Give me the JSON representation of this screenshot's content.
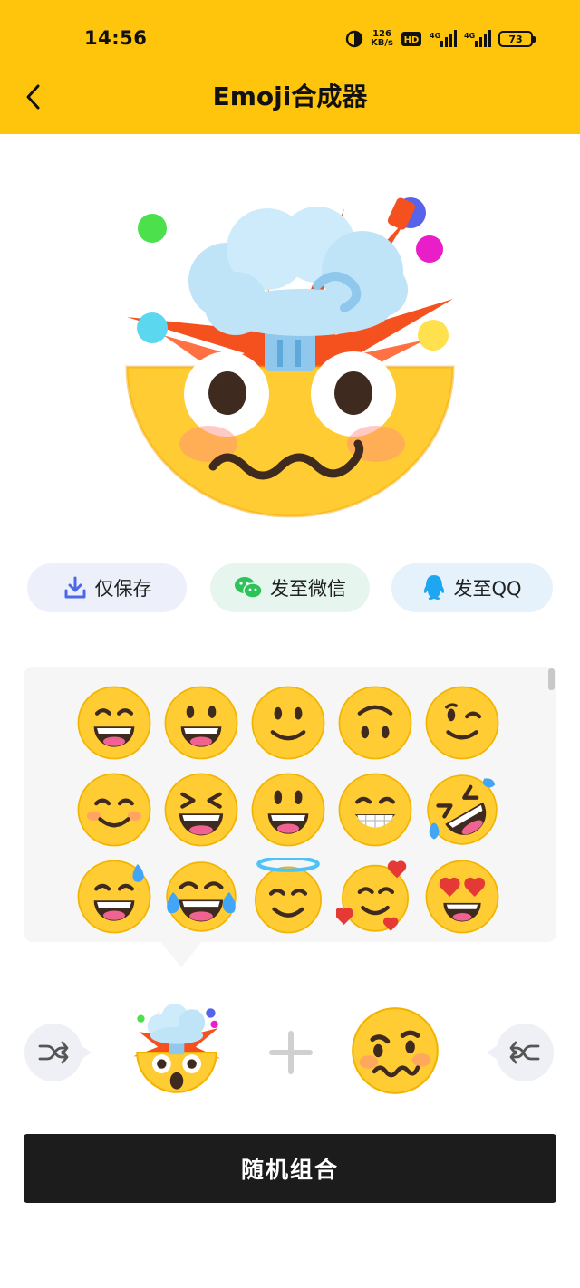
{
  "status": {
    "time": "14:56",
    "network_speed": "126",
    "battery": "73"
  },
  "header": {
    "title": "Emoji合成器",
    "back_icon": "chevron-left-icon"
  },
  "actions": {
    "save_label": "仅保存",
    "wechat_label": "发至微信",
    "qq_label": "发至QQ"
  },
  "emoji_grid": [
    "grinning-squinting-face",
    "grinning-face-big-eyes",
    "slightly-smiling-face",
    "upside-down-face",
    "winking-face",
    "smiling-face-smiling-eyes",
    "grinning-squinting-face-tight",
    "grinning-face",
    "beaming-face",
    "rolling-on-floor-laughing",
    "grinning-face-sweat",
    "face-with-tears-of-joy",
    "smiling-face-with-halo",
    "smiling-face-with-hearts",
    "smiling-face-heart-eyes"
  ],
  "combo": {
    "left_emoji": "exploding-head",
    "right_emoji": "woozy-face",
    "shuffle_icon": "shuffle-icon",
    "plus_icon": "plus-icon"
  },
  "random_label": "随机组合",
  "colors": {
    "brand_yellow": "#FFC40C",
    "emoji_yellow": "#FFCC33",
    "button_dark": "#1C1C1C"
  }
}
